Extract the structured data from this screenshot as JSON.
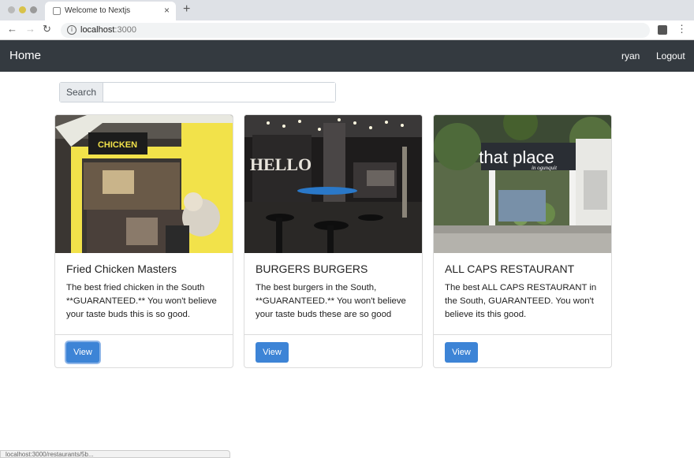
{
  "browser": {
    "tab_title": "Welcome to Nextjs",
    "url_host": "localhost",
    "url_port": ":3000",
    "status_text": "localhost:3000/restaurants/5b..."
  },
  "navbar": {
    "brand": "Home",
    "user": "ryan",
    "logout": "Logout"
  },
  "search": {
    "label": "Search",
    "value": "",
    "placeholder": ""
  },
  "cards": [
    {
      "title": "Fried Chicken Masters",
      "text": "The best fried chicken in the South **GUARANTEED.** You won't believe your taste buds this is so good.",
      "button": "View"
    },
    {
      "title": "BURGERS BURGERS",
      "text": "The best burgers in the South, **GUARANTEED.** You won't believe your taste buds these are so good",
      "button": "View"
    },
    {
      "title": "ALL CAPS RESTAURANT",
      "text": "The best ALL CAPS RESTAURANT in the South, GUARANTEED. You won't believe its this good.",
      "button": "View"
    }
  ],
  "images": {
    "card2_sign": "HELLO",
    "card3_sign": "that place",
    "card3_sub": "in ogunquit"
  },
  "colors": {
    "navbar_bg": "#343a40",
    "button_bg": "#3d84d6"
  }
}
